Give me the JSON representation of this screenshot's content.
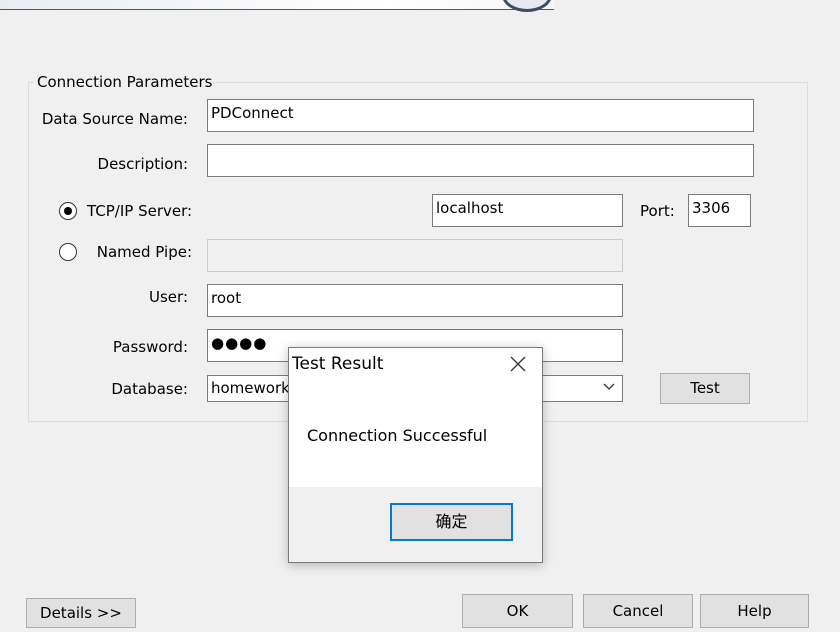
{
  "group": {
    "title": "Connection Parameters"
  },
  "fields": {
    "dsn": {
      "label": "Data Source Name:",
      "value": "PDConnect"
    },
    "description": {
      "label": "Description:",
      "value": ""
    },
    "tcp": {
      "label": "TCP/IP Server:",
      "value": "localhost",
      "checked": true
    },
    "port": {
      "label": "Port:",
      "value": "3306"
    },
    "pipe": {
      "label": "Named Pipe:",
      "value": "",
      "checked": false
    },
    "user": {
      "label": "User:",
      "value": "root"
    },
    "password": {
      "label": "Password:",
      "value": "●●●●"
    },
    "database": {
      "label": "Database:",
      "value": "homework"
    }
  },
  "buttons": {
    "test": "Test",
    "details": "Details >>",
    "ok": "OK",
    "cancel": "Cancel",
    "help": "Help"
  },
  "dialog": {
    "title": "Test Result",
    "message": "Connection Successful",
    "ok": "确定"
  },
  "icons": {
    "close": "close-icon",
    "dropdown": "chevron-down-icon"
  }
}
